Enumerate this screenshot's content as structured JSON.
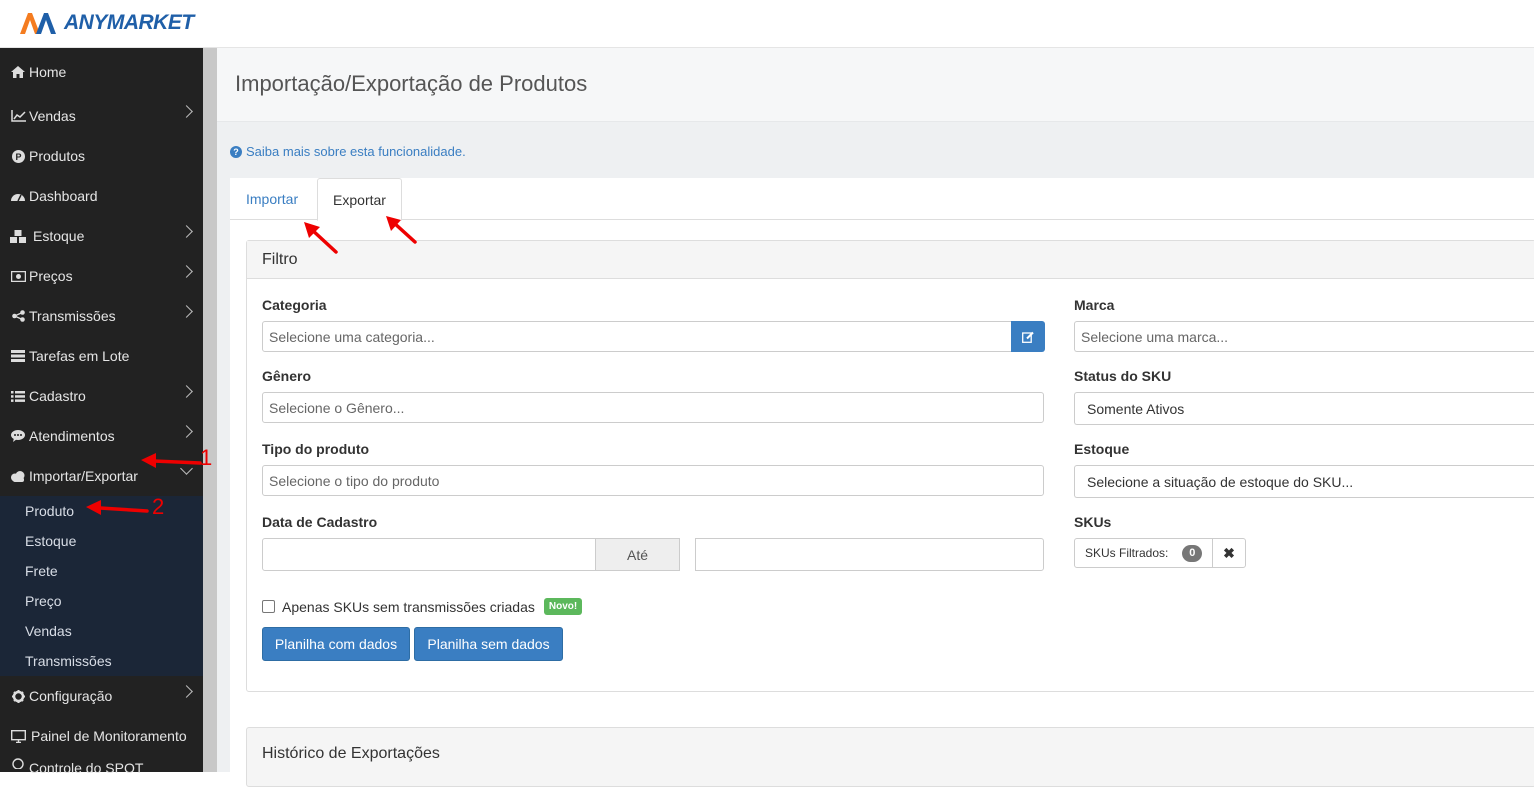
{
  "brand": {
    "name": "ANYMARKET",
    "logo_colors": [
      "#f47c20",
      "#1f5fa8"
    ]
  },
  "sidebar": {
    "items": [
      {
        "label": "Home",
        "icon": "home-icon",
        "has_submenu": false
      },
      {
        "label": "Vendas",
        "icon": "line-chart-icon",
        "has_submenu": true
      },
      {
        "label": "Produtos",
        "icon": "product-p-icon",
        "has_submenu": false
      },
      {
        "label": "Dashboard",
        "icon": "dashboard-icon",
        "has_submenu": false
      },
      {
        "label": "Estoque",
        "icon": "cubes-icon",
        "has_submenu": true
      },
      {
        "label": "Preços",
        "icon": "money-icon",
        "has_submenu": true
      },
      {
        "label": "Transmissões",
        "icon": "share-icon",
        "has_submenu": true
      },
      {
        "label": "Tarefas em Lote",
        "icon": "tasks-icon",
        "has_submenu": false
      },
      {
        "label": "Cadastro",
        "icon": "list-icon",
        "has_submenu": true
      },
      {
        "label": "Atendimentos",
        "icon": "comments-icon",
        "has_submenu": true
      },
      {
        "label": "Importar/Exportar",
        "icon": "cloud-icon",
        "has_submenu": true,
        "expanded": true
      }
    ],
    "submenu": [
      "Produto",
      "Estoque",
      "Frete",
      "Preço",
      "Vendas",
      "Transmissões"
    ],
    "items_after": [
      {
        "label": "Configuração",
        "icon": "gear-icon",
        "has_submenu": true
      },
      {
        "label": "Painel de Monitoramento",
        "icon": "monitor-icon",
        "has_submenu": false
      }
    ],
    "partial_item": "Controle do SPOT"
  },
  "page": {
    "title": "Importação/Exportação de Produtos",
    "help_link": "Saiba mais sobre esta funcionalidade.",
    "tabs": [
      {
        "label": "Importar",
        "active": false
      },
      {
        "label": "Exportar",
        "active": true
      }
    ]
  },
  "filter": {
    "title": "Filtro",
    "categoria": {
      "label": "Categoria",
      "placeholder": "Selecione uma categoria..."
    },
    "marca": {
      "label": "Marca",
      "placeholder": "Selecione uma marca..."
    },
    "genero": {
      "label": "Gênero",
      "placeholder": "Selecione o Gênero..."
    },
    "status_sku": {
      "label": "Status do SKU",
      "value": "Somente Ativos"
    },
    "tipo_produto": {
      "label": "Tipo do produto",
      "placeholder": "Selecione o tipo do produto"
    },
    "estoque": {
      "label": "Estoque",
      "value": "Selecione a situação de estoque do SKU..."
    },
    "data_cadastro": {
      "label": "Data de Cadastro",
      "separator": "Até"
    },
    "skus": {
      "label": "SKUs",
      "filtered_label": "SKUs Filtrados:",
      "count": "0",
      "clear": "✖"
    },
    "checkbox_label": "Apenas SKUs sem transmissões criadas",
    "new_badge": "Novo!",
    "btn_with_data": "Planilha com dados",
    "btn_without_data": "Planilha sem dados"
  },
  "history": {
    "title": "Histórico de Exportações"
  },
  "annotations": {
    "marker_1": "1",
    "marker_2": "2"
  },
  "colors": {
    "primary": "#3a7ec2",
    "sidebar_bg": "#222222",
    "submenu_bg": "#1b2637",
    "annotation": "#e00000",
    "badge_new": "#5cb85c"
  }
}
